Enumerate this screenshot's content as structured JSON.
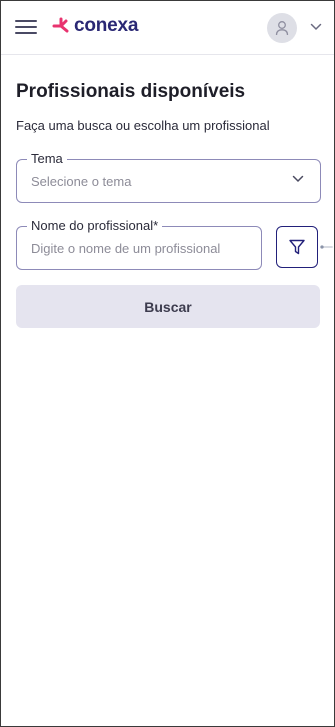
{
  "brand": {
    "name": "conexa"
  },
  "page": {
    "title": "Profissionais disponíveis",
    "subtitle": "Faça uma busca ou escolha um profissional"
  },
  "form": {
    "tema": {
      "label": "Tema",
      "placeholder": "Selecione o tema"
    },
    "nome": {
      "label": "Nome do profissional*",
      "placeholder": "Digite o nome de um profissional"
    },
    "submit_label": "Buscar"
  },
  "icons": {
    "menu": "menu-icon",
    "user": "user-icon",
    "chevron": "chevron-down-icon",
    "filter": "filter-icon"
  },
  "colors": {
    "brand_pink": "#e8336f",
    "brand_navy": "#2a2874",
    "field_border": "#8d8ab8",
    "button_bg": "#e5e4ef"
  }
}
